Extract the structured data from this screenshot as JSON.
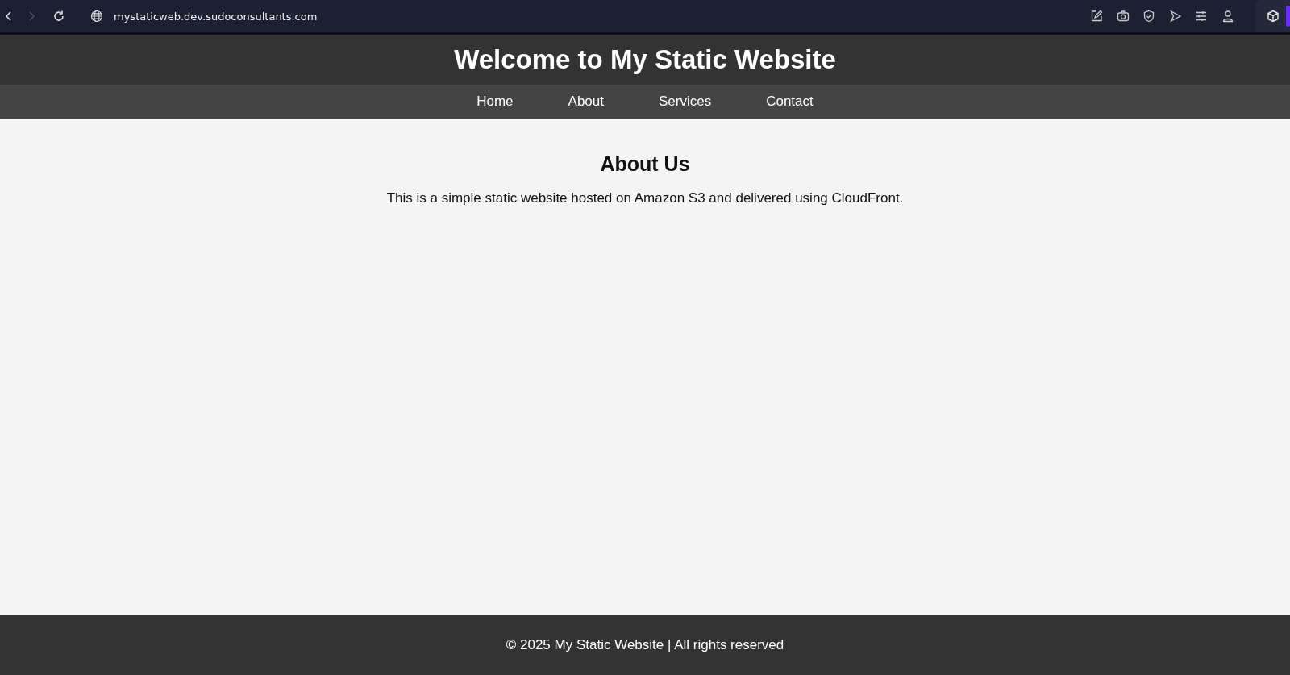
{
  "browser": {
    "nav_buttons": [
      {
        "kind": "back",
        "disabled": false
      },
      {
        "kind": "forward",
        "disabled": true
      },
      {
        "kind": "reload",
        "disabled": false
      }
    ],
    "url": "mystaticweb.dev.sudoconsultants.com"
  },
  "header": {
    "title": "Welcome to My Static Website"
  },
  "nav": {
    "items": [
      "Home",
      "About",
      "Services",
      "Contact"
    ]
  },
  "section": {
    "heading": "About Us",
    "text": "This is a simple static website hosted on Amazon S3 and delivered using CloudFront."
  },
  "footer": {
    "text": "© 2025 My Static Website | All rights reserved"
  }
}
